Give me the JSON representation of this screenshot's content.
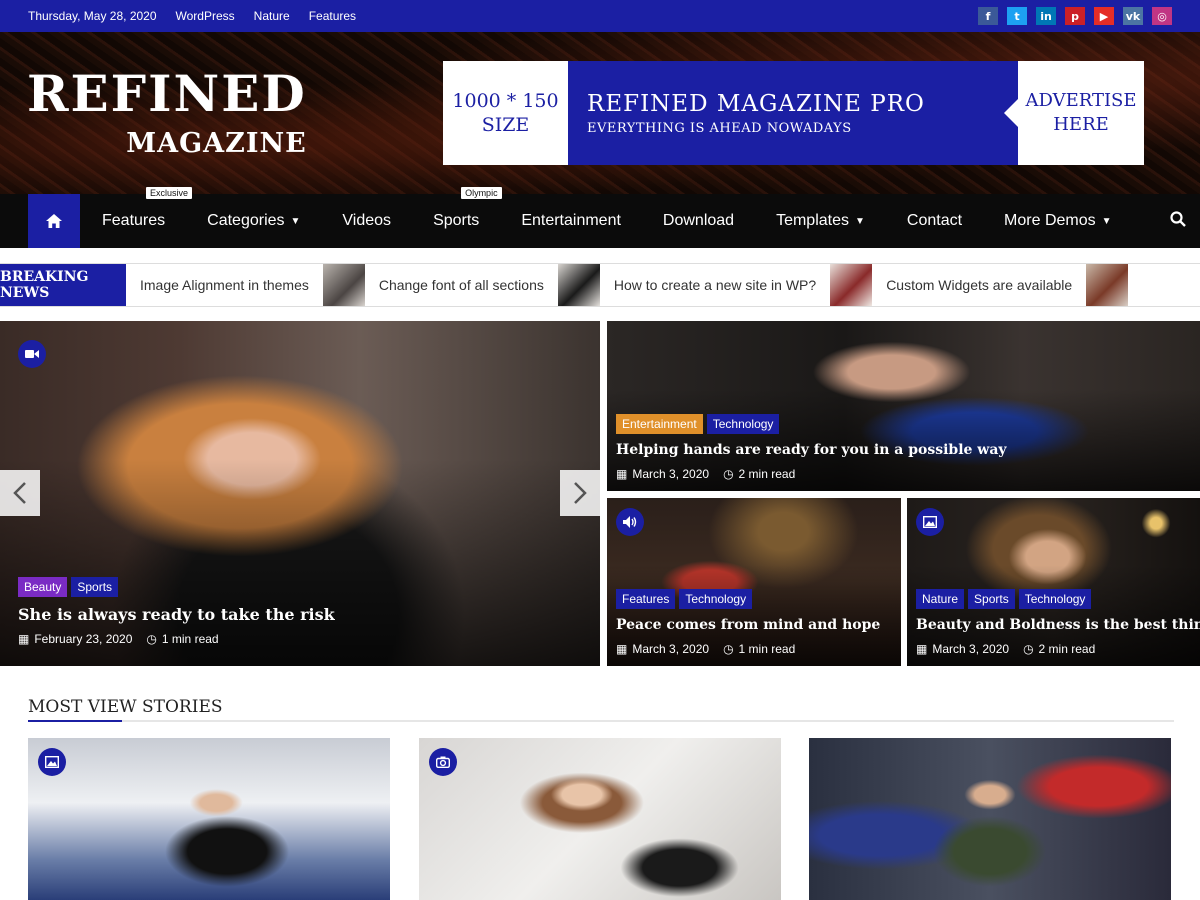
{
  "topbar": {
    "date": "Thursday, May 28, 2020",
    "links": [
      "WordPress",
      "Nature",
      "Features"
    ],
    "socials": [
      {
        "name": "facebook-icon",
        "glyph": "f",
        "color": "#3b5998"
      },
      {
        "name": "twitter-icon",
        "glyph": "t",
        "color": "#1da1f2"
      },
      {
        "name": "linkedin-icon",
        "glyph": "in",
        "color": "#0077b5"
      },
      {
        "name": "pinterest-icon",
        "glyph": "p",
        "color": "#cb2027"
      },
      {
        "name": "youtube-icon",
        "glyph": "▶",
        "color": "#e52d27"
      },
      {
        "name": "vk-icon",
        "glyph": "vk",
        "color": "#4c75a3"
      },
      {
        "name": "instagram-icon",
        "glyph": "◎",
        "color": "#c13584"
      }
    ]
  },
  "header": {
    "logo_line1": "REFINED",
    "logo_line2": "MAGAZINE",
    "ad": {
      "size_l1": "1000 * 150",
      "size_l2": "SIZE",
      "title": "REFINED MAGAZINE PRO",
      "subtitle": "EVERYTHING IS AHEAD NOWADAYS",
      "advertise_l1": "ADVERTISE",
      "advertise_l2": "HERE"
    }
  },
  "nav": {
    "items": [
      {
        "label": "Features",
        "tag": "Exclusive",
        "dropdown": false
      },
      {
        "label": "Categories",
        "tag": "",
        "dropdown": true
      },
      {
        "label": "Videos",
        "tag": "",
        "dropdown": false
      },
      {
        "label": "Sports",
        "tag": "Olympic",
        "dropdown": false
      },
      {
        "label": "Entertainment",
        "tag": "",
        "dropdown": false
      },
      {
        "label": "Download",
        "tag": "",
        "dropdown": false
      },
      {
        "label": "Templates",
        "tag": "",
        "dropdown": true
      },
      {
        "label": "Contact",
        "tag": "",
        "dropdown": false
      },
      {
        "label": "More Demos",
        "tag": "",
        "dropdown": true
      }
    ]
  },
  "breaking": {
    "label": "BREAKING NEWS",
    "items": [
      "Image Alignment in themes",
      "Change font of all sections",
      "How to create a new site in WP?",
      "Custom Widgets are available"
    ]
  },
  "featured": {
    "main": {
      "cats": [
        "Beauty",
        "Sports"
      ],
      "title": "She is always ready to take the risk",
      "date": "February 23, 2020",
      "read": "1 min read"
    },
    "top_right": {
      "cats": [
        "Entertainment",
        "Technology"
      ],
      "title": "Helping hands are ready for you in a possible way",
      "date": "March 3, 2020",
      "read": "2 min read"
    },
    "bottom_left": {
      "cats": [
        "Features",
        "Technology"
      ],
      "title": "Peace comes from mind and hope",
      "date": "March 3, 2020",
      "read": "1 min read"
    },
    "bottom_right": {
      "cats": [
        "Nature",
        "Sports",
        "Technology"
      ],
      "title": "Beauty and Boldness is the best thing today",
      "date": "March 3, 2020",
      "read": "2 min read"
    }
  },
  "cat_colors": {
    "Beauty": "#7a2bc4",
    "Sports": "#1b1fa3",
    "Entertainment": "#e0902a",
    "Technology": "#1b1fa3",
    "Features": "#1b1fa3",
    "Nature": "#1b1fa3"
  },
  "most_view": {
    "title": "MOST VIEW STORIES"
  }
}
